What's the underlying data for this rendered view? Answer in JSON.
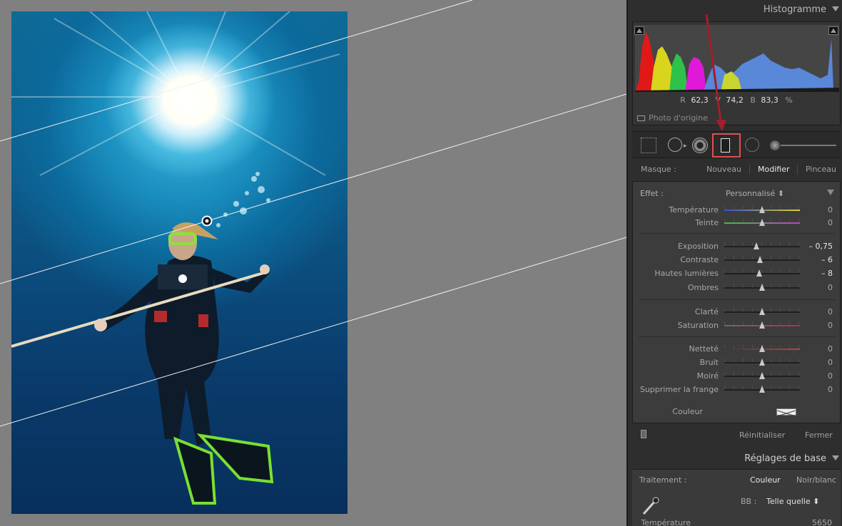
{
  "histogram": {
    "title": "Histogramme",
    "r_label": "R",
    "r_value": "62,3",
    "v_label": "V",
    "v_value": "74,2",
    "b_label": "B",
    "b_value": "83,3",
    "unit": "%",
    "original_photo": "Photo d'origine"
  },
  "mask": {
    "label": "Masque :",
    "new": "Nouveau",
    "edit": "Modifier",
    "brush": "Pinceau"
  },
  "effect": {
    "label": "Effet :",
    "value": "Personnalisé ⬍"
  },
  "sliders": [
    {
      "label": "Température",
      "value": "0",
      "pos": 0.5,
      "strong": false
    },
    {
      "label": "Teinte",
      "value": "0",
      "pos": 0.5,
      "strong": false
    },
    {
      "label": "Exposition",
      "value": "– 0,75",
      "pos": 0.42,
      "strong": true
    },
    {
      "label": "Contraste",
      "value": "– 6",
      "pos": 0.47,
      "strong": true
    },
    {
      "label": "Hautes lumières",
      "value": "– 8",
      "pos": 0.46,
      "strong": true
    },
    {
      "label": "Ombres",
      "value": "0",
      "pos": 0.5,
      "strong": false
    },
    {
      "label": "Clarté",
      "value": "0",
      "pos": 0.5,
      "strong": false
    },
    {
      "label": "Saturation",
      "value": "0",
      "pos": 0.5,
      "strong": false
    },
    {
      "label": "Netteté",
      "value": "0",
      "pos": 0.5,
      "strong": false
    },
    {
      "label": "Bruit",
      "value": "0",
      "pos": 0.5,
      "strong": false
    },
    {
      "label": "Moiré",
      "value": "0",
      "pos": 0.5,
      "strong": false
    },
    {
      "label": "Supprimer la frange",
      "value": "0",
      "pos": 0.5,
      "strong": false
    }
  ],
  "color": {
    "label": "Couleur"
  },
  "footer": {
    "reset": "Réinitialiser",
    "close": "Fermer"
  },
  "basic": {
    "title": "Réglages de base",
    "treatment_label": "Traitement :",
    "color": "Couleur",
    "bw": "Noir/blanc",
    "wb_label": "BB :",
    "wb_value": "Telle quelle ⬍",
    "temp_label": "Température",
    "temp_value": "5650"
  },
  "icons": {
    "crop": "crop-overlay-icon",
    "spot": "spot-removal-icon",
    "redeye": "red-eye-icon",
    "graduated": "graduated-filter-icon",
    "radial": "radial-filter-icon",
    "brush": "adjustment-brush-icon"
  },
  "colors": {
    "highlight_box": "#e05050",
    "arrow": "#a01f2a"
  }
}
